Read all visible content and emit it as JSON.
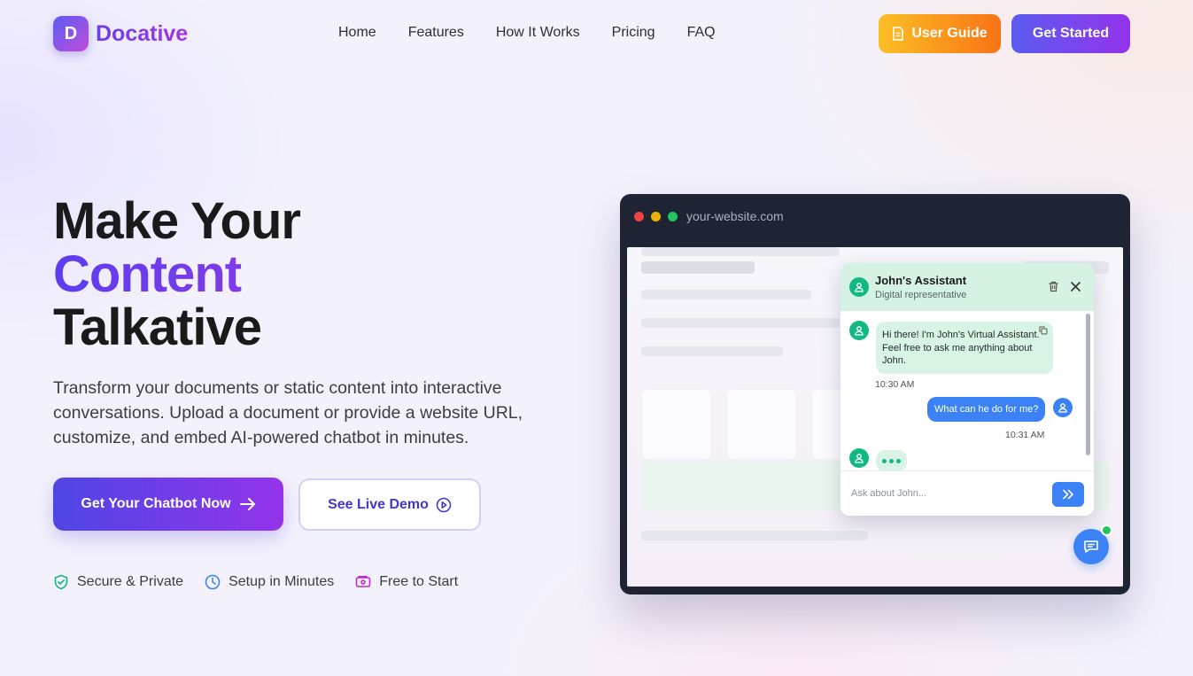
{
  "brand": {
    "logo_letter": "D",
    "name": "Docative"
  },
  "nav": {
    "links": [
      "Home",
      "Features",
      "How It Works",
      "Pricing",
      "FAQ"
    ],
    "user_guide": "User Guide",
    "get_started": "Get Started"
  },
  "hero": {
    "title_line1": "Make Your",
    "title_line2": "Content",
    "title_line3": "Talkative",
    "description": "Transform your documents or static content into interactive conversations. Upload a document or provide a website URL, customize, and embed AI-powered chatbot in minutes.",
    "primary_cta": "Get Your Chatbot Now",
    "secondary_cta": "See Live Demo",
    "features": [
      {
        "label": "Secure & Private",
        "icon": "shield-check-icon",
        "color": "#10b981"
      },
      {
        "label": "Setup in Minutes",
        "icon": "clock-icon",
        "color": "#3b82f6"
      },
      {
        "label": "Free to Start",
        "icon": "ticket-icon",
        "color": "#c026d3"
      }
    ]
  },
  "mockup": {
    "url": "your-website.com",
    "chat": {
      "assistant_name": "John's Assistant",
      "assistant_subtitle": "Digital representative",
      "bot_message": "Hi there! I'm John's Virtual Assistant. Feel free to ask me anything about John.",
      "bot_time": "10:30 AM",
      "user_message": "What can he do for me?",
      "user_time": "10:31 AM",
      "input_placeholder": "Ask about John..."
    }
  },
  "colors": {
    "primary": "#4f46e5",
    "accent": "#9333ea",
    "guide_start": "#fbbf24",
    "guide_end": "#f97316",
    "bot_green": "#10b981",
    "user_blue": "#3b82f6"
  }
}
